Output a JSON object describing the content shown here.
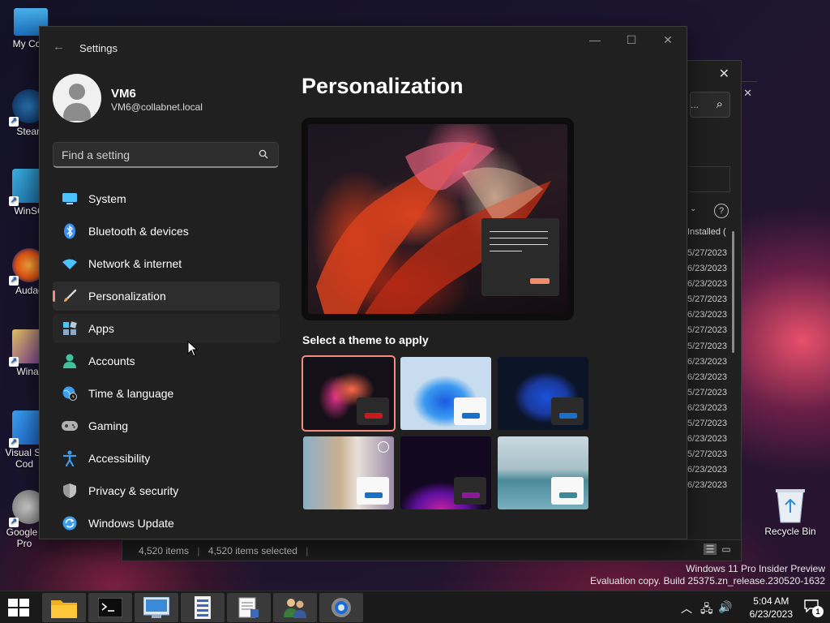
{
  "desktop": {
    "icons": [
      {
        "label": "My Com",
        "icon": "monitor-icon"
      },
      {
        "label": "Stean",
        "icon": "steam-icon"
      },
      {
        "label": "WinSC",
        "icon": "winscp-icon"
      },
      {
        "label": "Audac",
        "icon": "audacity-icon"
      },
      {
        "label": "Winar",
        "icon": "winrar-icon"
      },
      {
        "label": "Visual St Cod",
        "icon": "vscode-icon"
      },
      {
        "label": "Google l Pro",
        "icon": "google-earth-icon"
      }
    ],
    "recycle_bin": "Recycle Bin",
    "watermark_line1": "Windows 11 Pro Insider Preview",
    "watermark_line2": "Evaluation copy. Build 25375.zn_release.230520-1632"
  },
  "explorer": {
    "search_partial": "...",
    "column_header": "Installed (",
    "dates": [
      "5/27/2023",
      "6/23/2023",
      "6/23/2023",
      "5/27/2023",
      "6/23/2023",
      "5/27/2023",
      "5/27/2023",
      "6/23/2023",
      "6/23/2023",
      "5/27/2023",
      "6/23/2023",
      "5/27/2023",
      "6/23/2023",
      "5/27/2023",
      "6/23/2023",
      "6/23/2023"
    ],
    "status_items": "4,520 items",
    "status_selected": "4,520 items selected"
  },
  "settings": {
    "window_title": "Settings",
    "user_name": "VM6",
    "user_email": "VM6@collabnet.local",
    "search_placeholder": "Find a setting",
    "nav": [
      {
        "label": "System",
        "icon": "system-icon",
        "color": "#4cc2ff"
      },
      {
        "label": "Bluetooth & devices",
        "icon": "bluetooth-icon",
        "color": "#3a8ff0"
      },
      {
        "label": "Network & internet",
        "icon": "wifi-icon",
        "color": "#4cc2ff"
      },
      {
        "label": "Personalization",
        "icon": "brush-icon",
        "color": "#e8a060"
      },
      {
        "label": "Apps",
        "icon": "apps-icon",
        "color": "#8aa8c8"
      },
      {
        "label": "Accounts",
        "icon": "accounts-icon",
        "color": "#3ec29a"
      },
      {
        "label": "Time & language",
        "icon": "globe-clock-icon",
        "color": "#3a9ef0"
      },
      {
        "label": "Gaming",
        "icon": "gamepad-icon",
        "color": "#b0b0b0"
      },
      {
        "label": "Accessibility",
        "icon": "accessibility-icon",
        "color": "#3a9ef0"
      },
      {
        "label": "Privacy & security",
        "icon": "shield-icon",
        "color": "#9a9a9a"
      },
      {
        "label": "Windows Update",
        "icon": "update-icon",
        "color": "#3a9ef0"
      }
    ],
    "active_index": 3,
    "page_title": "Personalization",
    "theme_heading": "Select a theme to apply",
    "accent_color": "#f48b7f"
  },
  "taskbar": {
    "time": "5:04 AM",
    "date": "6/23/2023",
    "notification_count": "1",
    "apps": [
      "file-explorer-icon",
      "terminal-icon",
      "remote-desktop-icon",
      "registry-icon",
      "notepad-icon",
      "users-icon",
      "settings-gear-icon"
    ]
  }
}
